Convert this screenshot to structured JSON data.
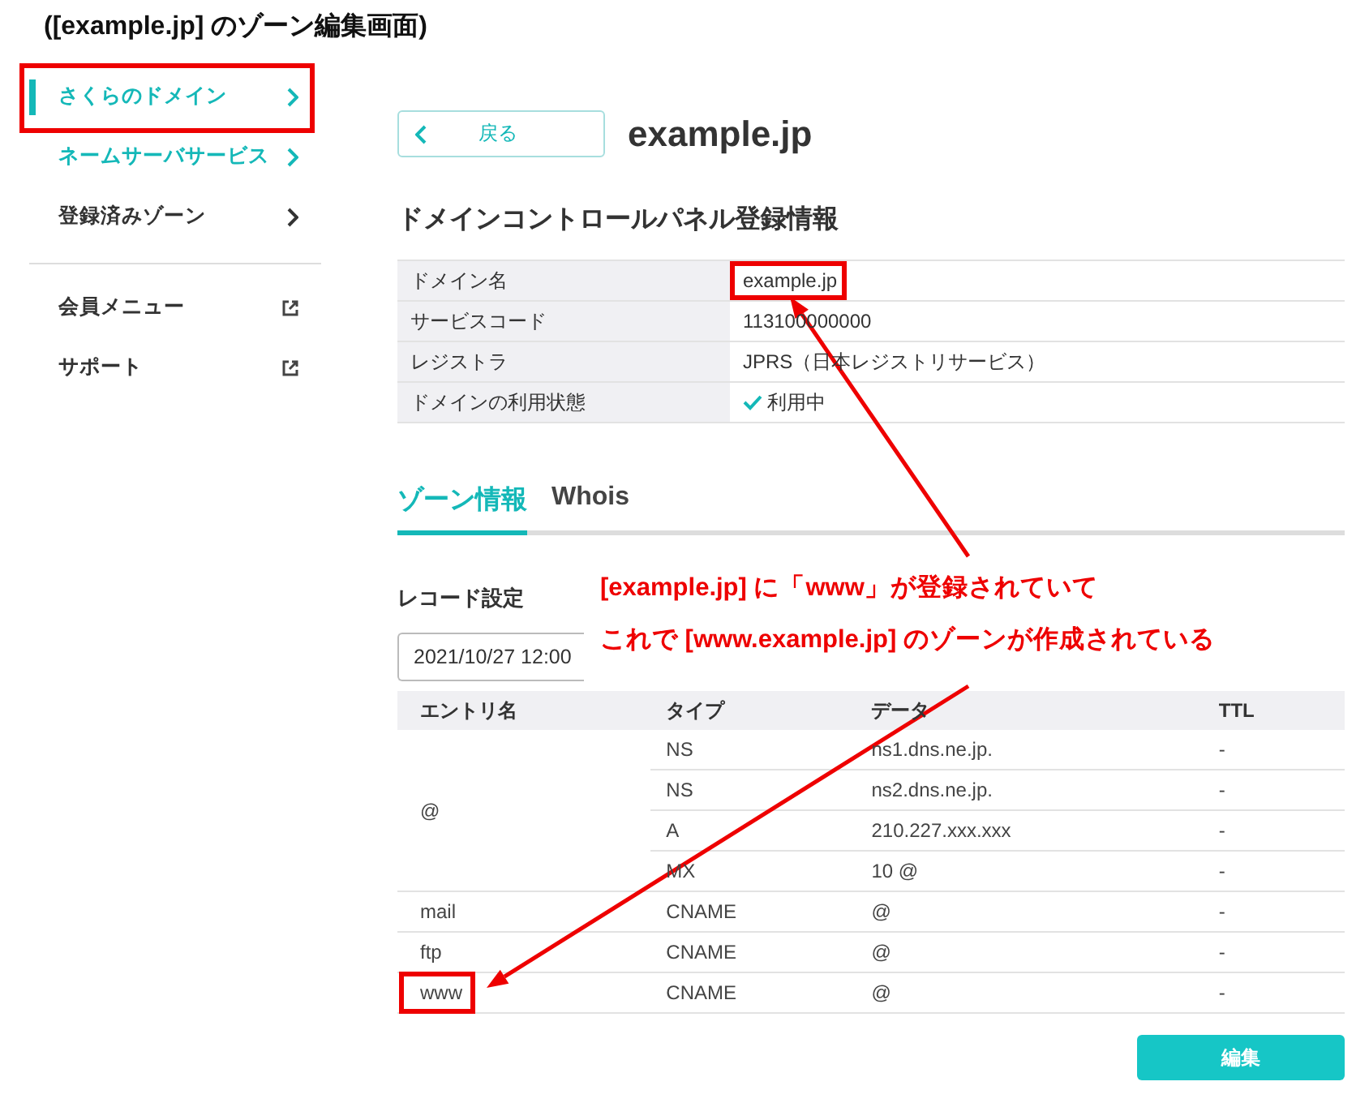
{
  "page_title": "([example.jp] のゾーン編集画面)",
  "sidebar": {
    "items": [
      {
        "label": "さくらのドメイン",
        "kind": "nav",
        "accent": true,
        "selected": true,
        "framed": true
      },
      {
        "label": "ネームサーバサービス",
        "kind": "nav",
        "accent": true,
        "selected": false,
        "framed": false
      },
      {
        "label": "登録済みゾーン",
        "kind": "nav",
        "accent": false,
        "selected": false,
        "framed": false
      },
      {
        "label": "会員メニュー",
        "kind": "external",
        "accent": false,
        "selected": false,
        "framed": false
      },
      {
        "label": "サポート",
        "kind": "external",
        "accent": false,
        "selected": false,
        "framed": false
      }
    ]
  },
  "back_button": {
    "label": "戻る"
  },
  "domain_title": "example.jp",
  "info_section": {
    "heading": "ドメインコントロールパネル登録情報",
    "rows": [
      {
        "label": "ドメイン名",
        "value": "example.jp",
        "kind": "text",
        "framed": true
      },
      {
        "label": "サービスコード",
        "value": "113100000000",
        "kind": "text",
        "framed": false
      },
      {
        "label": "レジストラ",
        "value": "JPRS（日本レジストリサービス）",
        "kind": "text",
        "framed": false
      },
      {
        "label": "ドメインの利用状態",
        "value": "利用中",
        "kind": "status",
        "framed": false
      }
    ]
  },
  "tabs": [
    {
      "label": "ゾーン情報",
      "selected": true
    },
    {
      "label": "Whois",
      "selected": false
    }
  ],
  "record_section": {
    "heading": "レコード設定",
    "date_value": "2021/10/27 12:00",
    "columns": [
      "エントリ名",
      "タイプ",
      "データ",
      "TTL"
    ],
    "groups": [
      {
        "entry": "@",
        "framed": false,
        "records": [
          {
            "type": "NS",
            "data": "ns1.dns.ne.jp.",
            "ttl": "-"
          },
          {
            "type": "NS",
            "data": "ns2.dns.ne.jp.",
            "ttl": "-"
          },
          {
            "type": "A",
            "data": "210.227.xxx.xxx",
            "ttl": "-"
          },
          {
            "type": "MX",
            "data": "10 @",
            "ttl": "-"
          }
        ]
      },
      {
        "entry": "mail",
        "framed": false,
        "records": [
          {
            "type": "CNAME",
            "data": "@",
            "ttl": "-"
          }
        ]
      },
      {
        "entry": "ftp",
        "framed": false,
        "records": [
          {
            "type": "CNAME",
            "data": "@",
            "ttl": "-"
          }
        ]
      },
      {
        "entry": "www",
        "framed": true,
        "records": [
          {
            "type": "CNAME",
            "data": "@",
            "ttl": "-"
          }
        ]
      }
    ]
  },
  "edit_button": {
    "label": "編集"
  },
  "annotation": {
    "lines": [
      "[example.jp] に「www」が登録されていて",
      "これで [www.example.jp] のゾーンが作成されている"
    ]
  }
}
